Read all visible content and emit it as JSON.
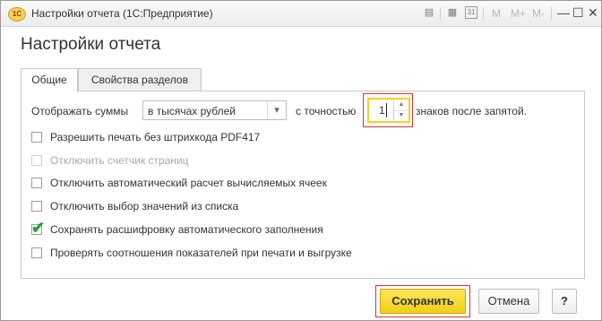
{
  "window": {
    "title": "Настройки отчета  (1С:Предприятие)",
    "logo_text": "1С",
    "toolbar": {
      "m": "M",
      "mplus": "M+",
      "mminus": "M-",
      "calendar_text": "31"
    },
    "controls": {
      "minimize": "—",
      "maximize": "☐",
      "close": "✕"
    }
  },
  "form": {
    "heading": "Настройки отчета",
    "tabs": [
      {
        "label": "Общие",
        "active": true
      },
      {
        "label": "Свойства разделов",
        "active": false
      }
    ],
    "display_sums": {
      "label": "Отображать суммы",
      "selected": "в тысячах рублей",
      "precision_label": "с точностью",
      "precision_value": "1",
      "precision_suffix": "знаков после запятой."
    },
    "checkboxes": [
      {
        "label": "Разрешить печать без штрихкода PDF417",
        "checked": false,
        "disabled": false
      },
      {
        "label": "Отключить счетчик страниц",
        "checked": false,
        "disabled": true
      },
      {
        "label": "Отключить автоматический расчет вычисляемых ячеек",
        "checked": false,
        "disabled": false
      },
      {
        "label": "Отключить выбор значений из списка",
        "checked": false,
        "disabled": false
      },
      {
        "label": "Сохранять расшифровку автоматического заполнения",
        "checked": true,
        "disabled": false
      },
      {
        "label": "Проверять соотношения показателей при печати и выгрузке",
        "checked": false,
        "disabled": false
      }
    ],
    "buttons": {
      "save": "Сохранить",
      "cancel": "Отмена",
      "help": "?"
    }
  },
  "colors": {
    "accent_yellow": "#f2d224",
    "highlight_red": "#e0312b",
    "check_green": "#2d9a3a"
  }
}
